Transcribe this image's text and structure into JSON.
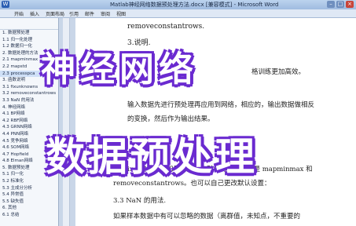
{
  "window": {
    "title": "Matlab神经网络数据预处理方法.docx [兼容模式] - Microsoft Word"
  },
  "menu": {
    "items": [
      "开始",
      "插入",
      "页面布局",
      "引用",
      "邮件",
      "审阅",
      "视图"
    ]
  },
  "nav": {
    "items": [
      "1. 数据预处理",
      "1.1 归一化处理",
      "1.2 数据归一化",
      "2. 数据处理的方法",
      "2.1 mapminmax",
      "2.2 mapstd",
      "2.3 processpca",
      "3. 函数说明",
      "3.1 fixunknowns",
      "3.2 removeconstantrows",
      "3.3 NaN 的用法",
      "4. 神经网络",
      "4.1 BP网络",
      "4.2 RBF网络",
      "4.3 GRNN网络",
      "4.4 PNN网络",
      "4.5 竞争网络",
      "4.6 SOM网络",
      "4.7 Hopfield",
      "4.8 Elman网络",
      "5. 数据预处理",
      "5.1 归一化",
      "5.2 标准化",
      "5.3 主成分分析",
      "5.4 异常值",
      "5.5 缺失值",
      "6. 其他",
      "6.1 总结"
    ]
  },
  "doc": {
    "line1": "removeconstantrows.",
    "line2": "3.说明.",
    "line3": "格训练更加高效。",
    "line4": "输入数据先进行预处理再应用到网络，相应的，输出数据做相反",
    "line5": "的变换，然后作为输出结果。",
    "line6": "ix，输入数据和目标数据，默认的处理函数是 mapminmax 和",
    "line7": "removeconstantrows。也可以自己更改默认设置：",
    "line8": "3.3 NaN 的用法.",
    "line9": "如果样本数据中有可以忽略的数据（离群值，未知点，不重要的"
  },
  "overlay": {
    "headline": "神经网络",
    "subheadline": "数据预处理"
  }
}
